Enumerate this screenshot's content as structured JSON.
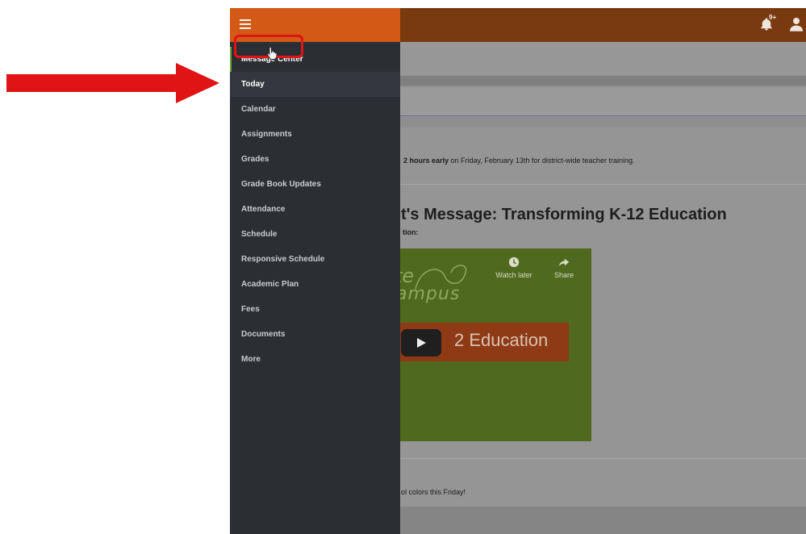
{
  "annotation": {
    "arrow_color": "#e01414"
  },
  "topbar": {
    "notifications_icon": "bell-icon",
    "notifications_badge": "9+",
    "user_icon": "user-icon",
    "color": "#7a3a10"
  },
  "sidebar": {
    "menu_icon": "hamburger-icon",
    "header_color": "#d25a16",
    "items": [
      {
        "label": "Message Center"
      },
      {
        "label": "Today"
      },
      {
        "label": "Calendar"
      },
      {
        "label": "Assignments"
      },
      {
        "label": "Grades"
      },
      {
        "label": "Grade Book Updates"
      },
      {
        "label": "Attendance"
      },
      {
        "label": "Schedule"
      },
      {
        "label": "Responsive Schedule"
      },
      {
        "label": "Academic Plan"
      },
      {
        "label": "Fees"
      },
      {
        "label": "Documents"
      },
      {
        "label": "More"
      }
    ]
  },
  "main": {
    "announcement_1_bold": "2 hours early",
    "announcement_1_rest": " on Friday, February 13th for district-wide teacher training.",
    "headline": "t's Message: Transforming K-12 Education",
    "subhead": "tion:",
    "announcement_2": "ol colors this Friday!"
  },
  "video": {
    "brand_line_1": "te",
    "brand_line_2": "ampus",
    "watch_later_label": "Watch later",
    "share_label": "Share",
    "banner_text": "2 Education",
    "play_icon": "play-icon"
  }
}
